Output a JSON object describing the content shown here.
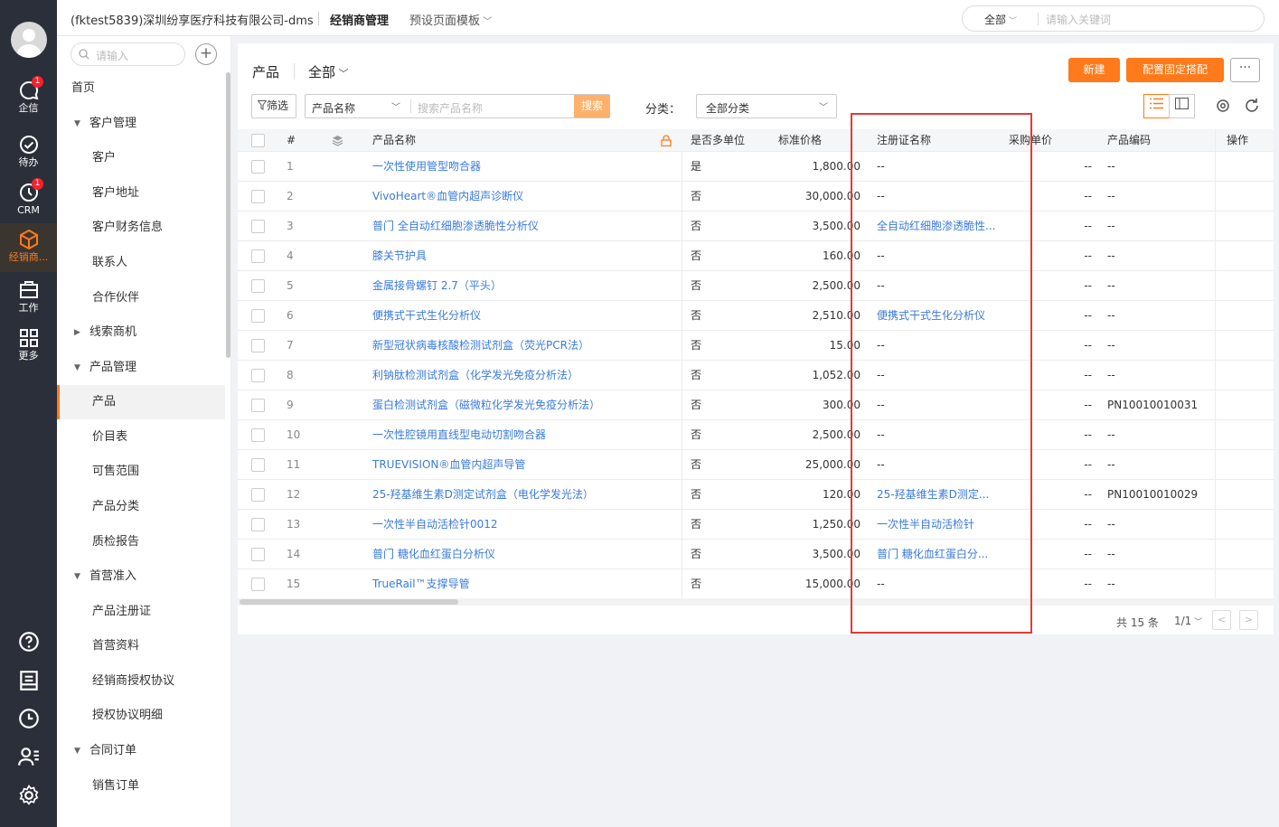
{
  "rail": {
    "items": [
      {
        "label": "企信",
        "badge": "1"
      },
      {
        "label": "待办",
        "badge": ""
      },
      {
        "label": "CRM",
        "badge": "1"
      },
      {
        "label": "经销商...",
        "badge": ""
      },
      {
        "label": "工作",
        "badge": ""
      },
      {
        "label": "更多",
        "badge": ""
      }
    ]
  },
  "topbar": {
    "company": "(fktest5839)深圳纷享医疗科技有限公司-dms",
    "module": "经销商管理",
    "template": "预设页面模板",
    "search_scope": "全部",
    "search_placeholder": "请输入关键词"
  },
  "sidebar": {
    "search_placeholder": "请输入",
    "plus": "+",
    "items": [
      {
        "label": "首页",
        "kind": "lvl0"
      },
      {
        "label": "客户管理",
        "kind": "grp",
        "caret": "▼"
      },
      {
        "label": "客户",
        "kind": "sub"
      },
      {
        "label": "客户地址",
        "kind": "sub"
      },
      {
        "label": "客户财务信息",
        "kind": "sub"
      },
      {
        "label": "联系人",
        "kind": "sub"
      },
      {
        "label": "合作伙伴",
        "kind": "sub"
      },
      {
        "label": "线索商机",
        "kind": "grp",
        "caret": "▶"
      },
      {
        "label": "产品管理",
        "kind": "grp",
        "caret": "▼"
      },
      {
        "label": "产品",
        "kind": "sub",
        "active": true
      },
      {
        "label": "价目表",
        "kind": "sub"
      },
      {
        "label": "可售范围",
        "kind": "sub"
      },
      {
        "label": "产品分类",
        "kind": "sub"
      },
      {
        "label": "质检报告",
        "kind": "sub"
      },
      {
        "label": "首营准入",
        "kind": "grp",
        "caret": "▼"
      },
      {
        "label": "产品注册证",
        "kind": "sub"
      },
      {
        "label": "首营资料",
        "kind": "sub"
      },
      {
        "label": "经销商授权协议",
        "kind": "sub"
      },
      {
        "label": "授权协议明细",
        "kind": "sub"
      },
      {
        "label": "合同订单",
        "kind": "grp",
        "caret": "▼"
      },
      {
        "label": "销售订单",
        "kind": "sub"
      }
    ]
  },
  "page": {
    "title": "产品",
    "view": "全部",
    "new_button": "新建",
    "config_button": "配置固定搭配",
    "more_button": "···",
    "filter_button": "筛选",
    "search_field": "产品名称",
    "search_placeholder": "搜索产品名称",
    "search_button": "搜索",
    "category_label": "分类：",
    "category_value": "全部分类"
  },
  "table": {
    "columns": [
      "#",
      "产品名称",
      "是否多单位",
      "标准价格",
      "注册证名称",
      "采购单价",
      "产品编码",
      "操作"
    ],
    "rows": [
      {
        "no": "1",
        "name": "一次性使用管型吻合器",
        "multi": "是",
        "price": "1,800.00",
        "cert": "--",
        "purchase": "--",
        "code": "--"
      },
      {
        "no": "2",
        "name": "VivoHeart®血管内超声诊断仪",
        "multi": "否",
        "price": "30,000.00",
        "cert": "--",
        "purchase": "--",
        "code": "--"
      },
      {
        "no": "3",
        "name": "普门 全自动红细胞渗透脆性分析仪",
        "multi": "否",
        "price": "3,500.00",
        "cert": "全自动红细胞渗透脆性...",
        "purchase": "--",
        "code": "--"
      },
      {
        "no": "4",
        "name": "膝关节护具",
        "multi": "否",
        "price": "160.00",
        "cert": "--",
        "purchase": "--",
        "code": "--"
      },
      {
        "no": "5",
        "name": "金属接骨螺钉 2.7（平头）",
        "multi": "否",
        "price": "2,500.00",
        "cert": "--",
        "purchase": "--",
        "code": "--"
      },
      {
        "no": "6",
        "name": "便携式干式生化分析仪",
        "multi": "否",
        "price": "2,510.00",
        "cert": "便携式干式生化分析仪",
        "purchase": "--",
        "code": "--"
      },
      {
        "no": "7",
        "name": "新型冠状病毒核酸检测试剂盒（荧光PCR法）",
        "multi": "否",
        "price": "15.00",
        "cert": "--",
        "purchase": "--",
        "code": "--"
      },
      {
        "no": "8",
        "name": "利钠肽检测试剂盒（化学发光免疫分析法）",
        "multi": "否",
        "price": "1,052.00",
        "cert": "--",
        "purchase": "--",
        "code": "--"
      },
      {
        "no": "9",
        "name": "蛋白检测试剂盒（磁微粒化学发光免疫分析法）",
        "multi": "否",
        "price": "300.00",
        "cert": "--",
        "purchase": "--",
        "code": "PN10010010031"
      },
      {
        "no": "10",
        "name": "一次性腔镜用直线型电动切割吻合器",
        "multi": "否",
        "price": "2,500.00",
        "cert": "--",
        "purchase": "--",
        "code": "--"
      },
      {
        "no": "11",
        "name": "TRUEVISION®血管内超声导管",
        "multi": "否",
        "price": "25,000.00",
        "cert": "--",
        "purchase": "--",
        "code": "--"
      },
      {
        "no": "12",
        "name": "25-羟基维生素D测定试剂盒（电化学发光法）",
        "multi": "否",
        "price": "120.00",
        "cert": "25-羟基维生素D测定...",
        "purchase": "--",
        "code": "PN10010010029"
      },
      {
        "no": "13",
        "name": "一次性半自动活检针0012",
        "multi": "否",
        "price": "1,250.00",
        "cert": "一次性半自动活检针",
        "purchase": "--",
        "code": "--"
      },
      {
        "no": "14",
        "name": "普门 糖化血红蛋白分析仪",
        "multi": "否",
        "price": "3,500.00",
        "cert": "普门 糖化血红蛋白分...",
        "purchase": "--",
        "code": "--"
      },
      {
        "no": "15",
        "name": "TrueRail™支撑导管",
        "multi": "否",
        "price": "15,000.00",
        "cert": "--",
        "purchase": "--",
        "code": "--"
      }
    ]
  },
  "pager": {
    "total": "共 15 条",
    "page": "1/1",
    "prev": "<",
    "next": ">"
  },
  "colors": {
    "accent": "#ff7a1a",
    "link": "#3a7bdc",
    "rail_bg": "#2b2f3a",
    "highlight_box": "#e53935"
  }
}
